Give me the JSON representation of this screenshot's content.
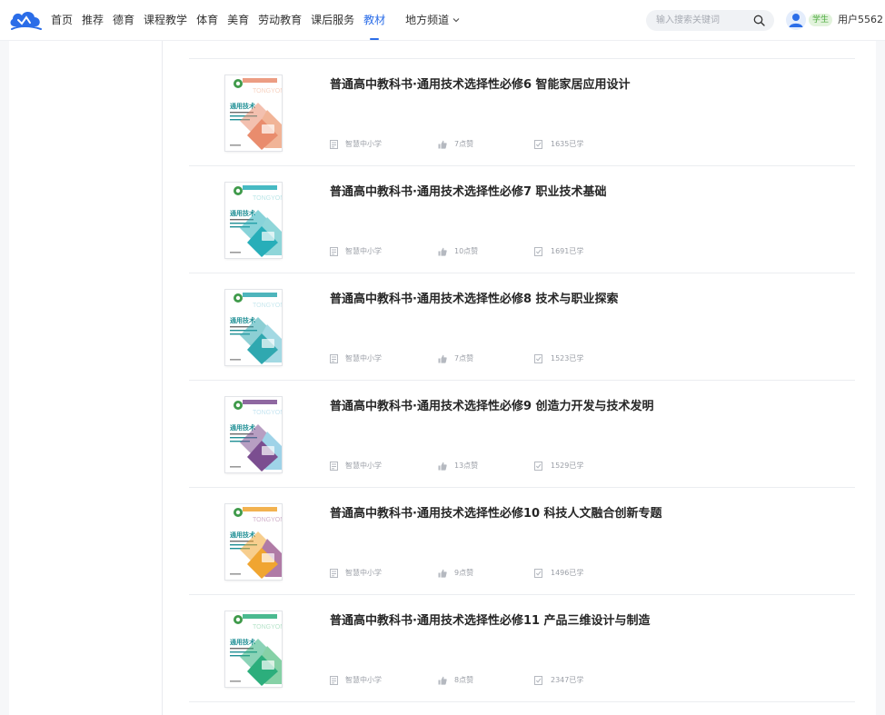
{
  "header": {
    "nav": [
      {
        "label": "首页",
        "active": false
      },
      {
        "label": "推荐",
        "active": false
      },
      {
        "label": "德育",
        "active": false
      },
      {
        "label": "课程教学",
        "active": false
      },
      {
        "label": "体育",
        "active": false
      },
      {
        "label": "美育",
        "active": false
      },
      {
        "label": "劳动教育",
        "active": false
      },
      {
        "label": "课后服务",
        "active": false
      },
      {
        "label": "教材",
        "active": true
      }
    ],
    "local_channel": "地方频道",
    "search_placeholder": "输入搜索关键词",
    "role_badge": "学生",
    "username": "用户5562"
  },
  "colors": {
    "accent": "#2b6de8",
    "badge_green": "#4caa3e",
    "cover_teal": "#2fb5b4",
    "cover_orange": "#e7825c",
    "cover_purple": "#7a4f8f"
  },
  "books": [
    {
      "title": "普通高中教科书·通用技术选择性必修6 智能家居应用设计",
      "publisher": "智慧中小学",
      "likes": "7点赞",
      "learners": "1635已学",
      "cover_accent": "#e98c6d",
      "cover_accent2": "#f1b497",
      "cover_icon": "smartphone"
    },
    {
      "title": "普通高中教科书·通用技术选择性必修7 职业技术基础",
      "publisher": "智慧中小学",
      "likes": "10点赞",
      "learners": "1691已学",
      "cover_accent": "#27aeb9",
      "cover_accent2": "#8fd6d9",
      "cover_icon": "factory"
    },
    {
      "title": "普通高中教科书·通用技术选择性必修8 技术与职业探索",
      "publisher": "智慧中小学",
      "likes": "7点赞",
      "learners": "1523已学",
      "cover_accent": "#2fa8b0",
      "cover_accent2": "#a3d9e3",
      "cover_icon": "bridge"
    },
    {
      "title": "普通高中教科书·通用技术选择性必修9 创造力开发与技术发明",
      "publisher": "智慧中小学",
      "likes": "13点赞",
      "learners": "1529已学",
      "cover_accent": "#7b4e90",
      "cover_accent2": "#9fd3e8",
      "cover_icon": "tablet"
    },
    {
      "title": "普通高中教科书·通用技术选择性必修10 科技人文融合创新专题",
      "publisher": "智慧中小学",
      "likes": "9点赞",
      "learners": "1496已学",
      "cover_accent": "#f0a531",
      "cover_accent2": "#b07ba6",
      "cover_icon": "globe"
    },
    {
      "title": "普通高中教科书·通用技术选择性必修11 产品三维设计与制造",
      "publisher": "智慧中小学",
      "likes": "8点赞",
      "learners": "2347已学",
      "cover_accent": "#2cae7c",
      "cover_accent2": "#86d1a6",
      "cover_icon": "printer"
    }
  ]
}
